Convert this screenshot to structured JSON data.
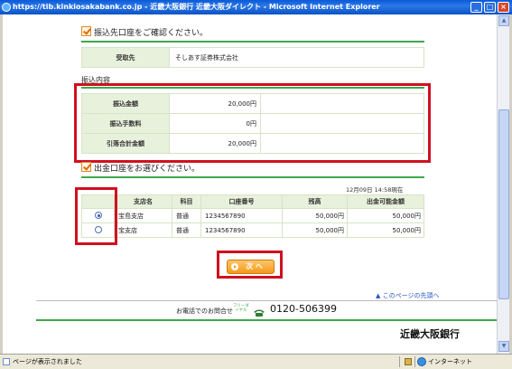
{
  "window": {
    "title": "https://tib.kinkiosakabank.co.jp - 近畿大阪銀行 近畿大阪ダイレクト - Microsoft Internet Explorer",
    "min": "_",
    "max": "□",
    "close": "×"
  },
  "payee": {
    "heading": "振込先口座をご確認ください。",
    "label": "受取先",
    "value": "そしあす証券株式会社"
  },
  "transfer": {
    "heading": "振込内容",
    "rows": [
      {
        "label": "振込金額",
        "value": "20,000円"
      },
      {
        "label": "振込手数料",
        "value": "0円"
      },
      {
        "label": "引落合計金額",
        "value": "20,000円"
      }
    ]
  },
  "account": {
    "heading": "出金口座をお選びください。",
    "timestamp": "12月09日 14:58現在",
    "columns": [
      "",
      "支店名",
      "科目",
      "口座番号",
      "残高",
      "出金可能金額"
    ],
    "rows": [
      {
        "selected": true,
        "branch": "宝島支店",
        "type": "普通",
        "number": "1234567890",
        "balance": "50,000円",
        "available": "50,000円"
      },
      {
        "selected": false,
        "branch": "宝支店",
        "type": "普通",
        "number": "1234567890",
        "balance": "50,000円",
        "available": "50,000円"
      }
    ]
  },
  "next_button": {
    "label": "次 へ"
  },
  "page_top_link": "▲ このページの先頭へ",
  "contact": {
    "label": "お電話でのお問合せ",
    "freedial": "フリーダイヤル",
    "phone": "0120-506399"
  },
  "bank_name": "近畿大阪銀行",
  "status": {
    "text": "ページが表示されました",
    "zone": "インターネット"
  },
  "colors": {
    "accent_red": "#d0101f",
    "header_green": "#3fa84c",
    "cell_green": "#e8f1dc",
    "button_orange": "#f29a1c"
  }
}
